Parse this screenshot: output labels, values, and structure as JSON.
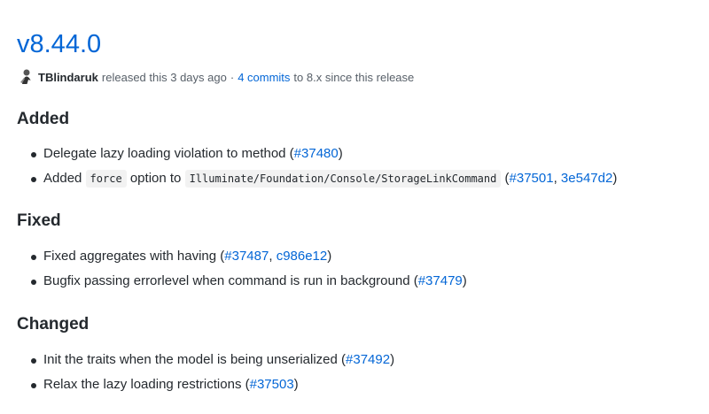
{
  "release": {
    "title": "v8.44.0",
    "author": "TBlindaruk",
    "released_text": "released this 3 days ago",
    "separator": "·",
    "commits_link": "4 commits",
    "commits_suffix": "to 8.x since this release"
  },
  "sections": [
    {
      "heading": "Added",
      "items": [
        {
          "text": "Delegate lazy loading violation to method (",
          "link1": "#37480",
          "close": ")"
        },
        {
          "pre": "Added",
          "code1": "force",
          "mid": "option to",
          "code2": "Illuminate/Foundation/Console/StorageLinkCommand",
          "open": "(",
          "link1": "#37501",
          "comma": ",",
          "link2": "3e547d2",
          "close": ")"
        }
      ]
    },
    {
      "heading": "Fixed",
      "items": [
        {
          "text": "Fixed aggregates with having (",
          "link1": "#37487",
          "comma": ",",
          "link2": "c986e12",
          "close": ")"
        },
        {
          "text": "Bugfix passing errorlevel when command is run in background (",
          "link1": "#37479",
          "close": ")"
        }
      ]
    },
    {
      "heading": "Changed",
      "items": [
        {
          "text": "Init the traits when the model is being unserialized (",
          "link1": "#37492",
          "close": ")"
        },
        {
          "text": "Relax the lazy loading restrictions (",
          "link1": "#37503",
          "close": ")"
        }
      ]
    }
  ],
  "colors": {
    "link": "#0366d6",
    "text": "#24292e",
    "muted": "#586069"
  },
  "icons": {
    "avatar": "user-avatar-icon"
  }
}
